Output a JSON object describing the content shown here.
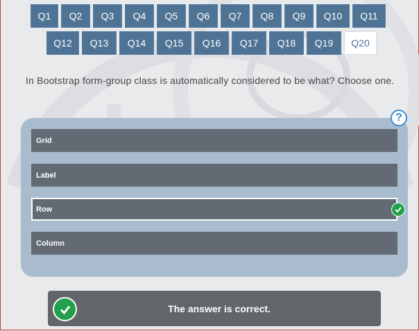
{
  "nav": {
    "row1": [
      "Q1",
      "Q2",
      "Q3",
      "Q4",
      "Q5",
      "Q6",
      "Q7",
      "Q8",
      "Q9",
      "Q10",
      "Q11"
    ],
    "row2": [
      "Q12",
      "Q13",
      "Q14",
      "Q15",
      "Q16",
      "Q17",
      "Q18",
      "Q19",
      "Q20"
    ],
    "active": "Q20"
  },
  "question": {
    "text": "In Bootstrap form-group class is automatically considered to be what? Choose one."
  },
  "options": [
    {
      "label": "Grid",
      "selected": false
    },
    {
      "label": "Label",
      "selected": false
    },
    {
      "label": "Row",
      "selected": true
    },
    {
      "label": "Column",
      "selected": false
    }
  ],
  "help": {
    "icon": "help-icon",
    "symbol": "?"
  },
  "result": {
    "text": "The answer is correct.",
    "icon": "check-circle-icon"
  },
  "colors": {
    "nav_button": "#4f7395",
    "option_bg": "#626a73",
    "panel_bg": "#a8bccd",
    "correct": "#22a04b",
    "result_bg": "#626569"
  }
}
